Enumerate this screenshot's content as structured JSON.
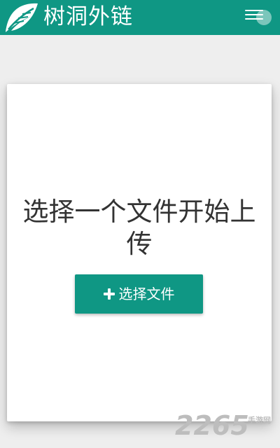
{
  "header": {
    "title": "树洞外链",
    "logo_icon": "leaf-icon",
    "menu_icon": "hamburger-menu-icon",
    "background_color": "#0f9784"
  },
  "main": {
    "title": "选择一个文件开始上传",
    "select_button": {
      "icon": "plus-icon",
      "label": "选择文件",
      "color": "#0f9784"
    }
  },
  "watermark": {
    "number": "2265",
    "suffix": "手游网",
    "text": "2265手游网"
  }
}
